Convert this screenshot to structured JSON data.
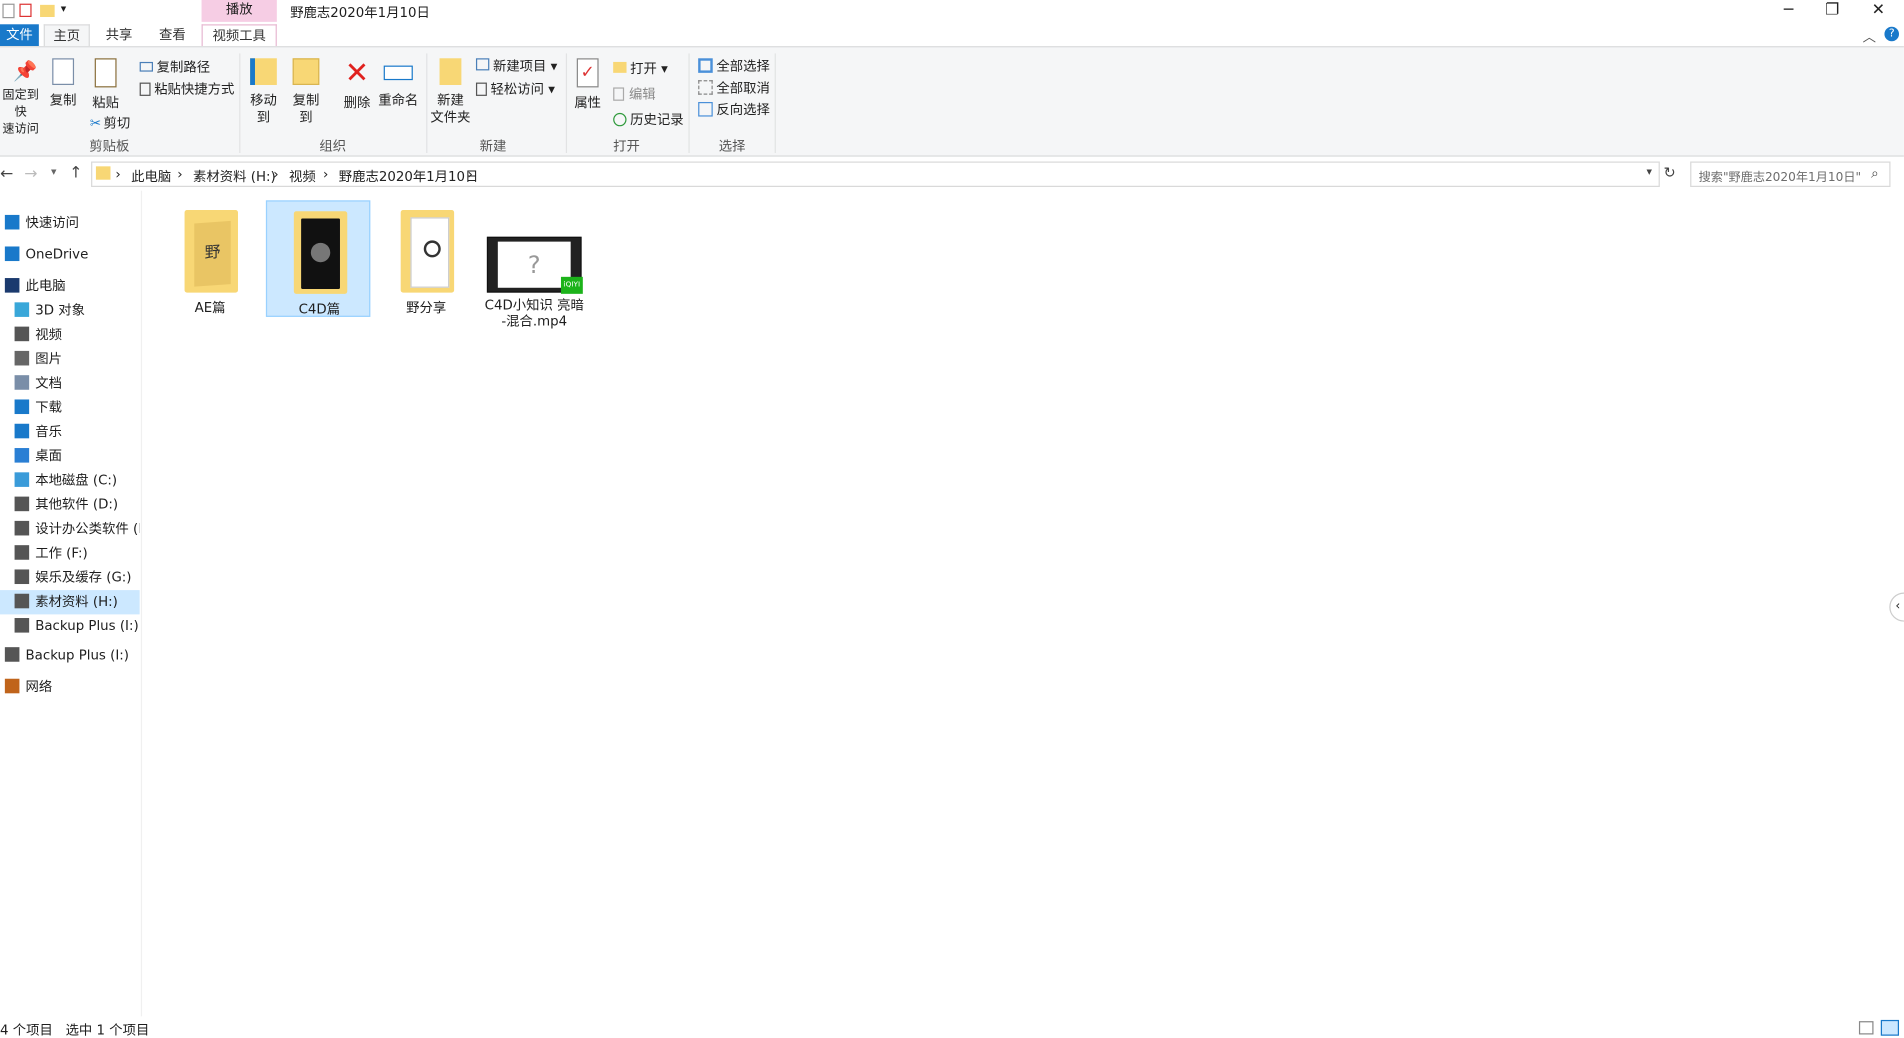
{
  "window": {
    "title": "野鹿志2020年1月10日",
    "context_tab": "播放",
    "minimize": "─",
    "maximize": "❐",
    "close": "✕"
  },
  "tabs": [
    {
      "label": "文件"
    },
    {
      "label": "主页"
    },
    {
      "label": "共享"
    },
    {
      "label": "查看"
    },
    {
      "label": "视频工具"
    }
  ],
  "ribbon": {
    "pin": "固定到快\n速访问",
    "copy": "复制",
    "paste": "粘贴",
    "copy_path": "复制路径",
    "paste_shortcut": "粘贴快捷方式",
    "cut": "剪切",
    "clipboard_group": "剪贴板",
    "move_to": "移动到",
    "copy_to": "复制到",
    "delete": "删除",
    "rename": "重命名",
    "organize_group": "组织",
    "new_folder": "新建\n文件夹",
    "new_item": "新建项目 ▾",
    "easy_access": "轻松访问 ▾",
    "new_group": "新建",
    "properties": "属性",
    "open": "打开 ▾",
    "edit": "编辑",
    "history": "历史记录",
    "open_group": "打开",
    "select_all": "全部选择",
    "select_none": "全部取消",
    "invert_selection": "反向选择",
    "select_group": "选择"
  },
  "address": {
    "crumbs": [
      "此电脑",
      "素材资料 (H:)",
      "视频",
      "野鹿志2020年1月10日"
    ],
    "search_placeholder": "搜索\"野鹿志2020年1月10日\""
  },
  "nav": [
    {
      "label": "快速访问",
      "icon": "star-icon",
      "color": "#1979ca"
    },
    {
      "label": "OneDrive",
      "icon": "cloud-icon",
      "color": "#1979ca"
    },
    {
      "label": "此电脑",
      "icon": "computer-icon",
      "color": "#1b3a6e"
    },
    {
      "label": "3D 对象",
      "icon": "cube-icon",
      "color": "#39a7d9"
    },
    {
      "label": "视频",
      "icon": "film-icon",
      "color": "#555"
    },
    {
      "label": "图片",
      "icon": "picture-icon",
      "color": "#666"
    },
    {
      "label": "文档",
      "icon": "document-icon",
      "color": "#7a8ea8"
    },
    {
      "label": "下载",
      "icon": "download-icon",
      "color": "#1979ca"
    },
    {
      "label": "音乐",
      "icon": "music-icon",
      "color": "#1979ca"
    },
    {
      "label": "桌面",
      "icon": "desktop-icon",
      "color": "#2a7fd4"
    },
    {
      "label": "本地磁盘 (C:)",
      "icon": "drive-icon",
      "color": "#3a9bd9"
    },
    {
      "label": "其他软件 (D:)",
      "icon": "drive-icon",
      "color": "#555"
    },
    {
      "label": "设计办公类软件 (E:",
      "icon": "drive-icon",
      "color": "#555"
    },
    {
      "label": "工作 (F:)",
      "icon": "drive-icon",
      "color": "#555"
    },
    {
      "label": "娱乐及缓存 (G:)",
      "icon": "drive-icon",
      "color": "#555"
    },
    {
      "label": "素材资料 (H:)",
      "icon": "drive-icon",
      "color": "#555"
    },
    {
      "label": "Backup Plus (I:)",
      "icon": "drive-icon",
      "color": "#555"
    },
    {
      "label": "Backup Plus (I:)",
      "icon": "drive-icon",
      "color": "#555"
    },
    {
      "label": "网络",
      "icon": "network-icon",
      "color": "#c0641b"
    }
  ],
  "files": [
    {
      "name": "AE篇",
      "type": "folder"
    },
    {
      "name": "C4D篇",
      "type": "folder"
    },
    {
      "name": "野分享",
      "type": "folder"
    },
    {
      "name": "C4D小知识 亮暗\n-混合.mp4",
      "type": "video"
    }
  ],
  "status": {
    "count": "4 个项目",
    "selected": "选中 1 个项目"
  },
  "colors": {
    "accent": "#1979ca",
    "selection": "#cce8ff",
    "context_tab": "#f6cde4",
    "folder": "#f8d775"
  }
}
